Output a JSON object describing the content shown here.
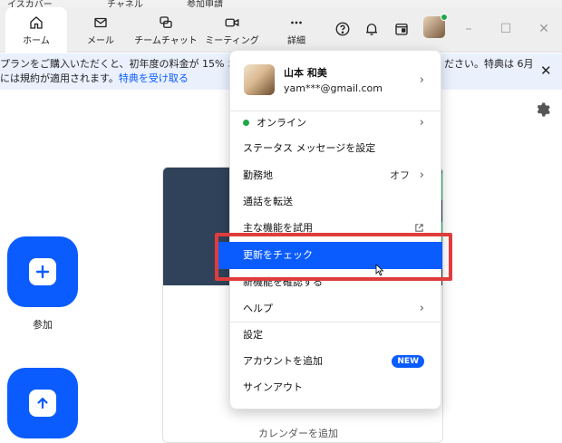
{
  "top_strip": {
    "fragments": [
      "イスカバー",
      "チャネル",
      "参加申請"
    ]
  },
  "nav": {
    "tabs": [
      {
        "label": "ホーム",
        "icon": "home-icon",
        "active": true
      },
      {
        "label": "メール",
        "icon": "mail-icon",
        "active": false
      },
      {
        "label": "チームチャット",
        "icon": "chat-icon",
        "active": false
      },
      {
        "label": "ミーティング",
        "icon": "video-icon",
        "active": false
      },
      {
        "label": "詳細",
        "icon": "more-icon",
        "active": false
      }
    ],
    "right_icons": [
      "help-icon",
      "bell-icon",
      "calendar-icon"
    ],
    "window_controls": {
      "minimize": "–",
      "maximize": "☐",
      "close": "✕"
    }
  },
  "banner": {
    "line1_left": "プランをご購入いただくと、初年度の料金が 15% オフに",
    "line1_right": "ださい。特典は 6月",
    "line2_prefix": "には規約が適用されます。",
    "line2_link": "特典を受け取る",
    "close": "✕"
  },
  "home": {
    "join_label": "参加",
    "card_bottom_text": "カレンダーを追加"
  },
  "menu": {
    "profile": {
      "name": "山本 和美",
      "email": "yam***@gmail.com"
    },
    "status": "オンライン",
    "status_message": "ステータス メッセージを設定",
    "work_location": "勤務地",
    "work_location_value": "オフ",
    "call_forward": "通話を転送",
    "try_features": "主な機能を試用",
    "check_updates": "更新をチェック",
    "new_features": "新機能を確認する",
    "help": "ヘルプ",
    "settings": "設定",
    "add_account": "アカウントを追加",
    "new_badge": "NEW",
    "sign_out": "サインアウト"
  },
  "colors": {
    "accent": "#0b5cff",
    "highlight_border": "#e03c3c",
    "online": "#1fa84a"
  }
}
